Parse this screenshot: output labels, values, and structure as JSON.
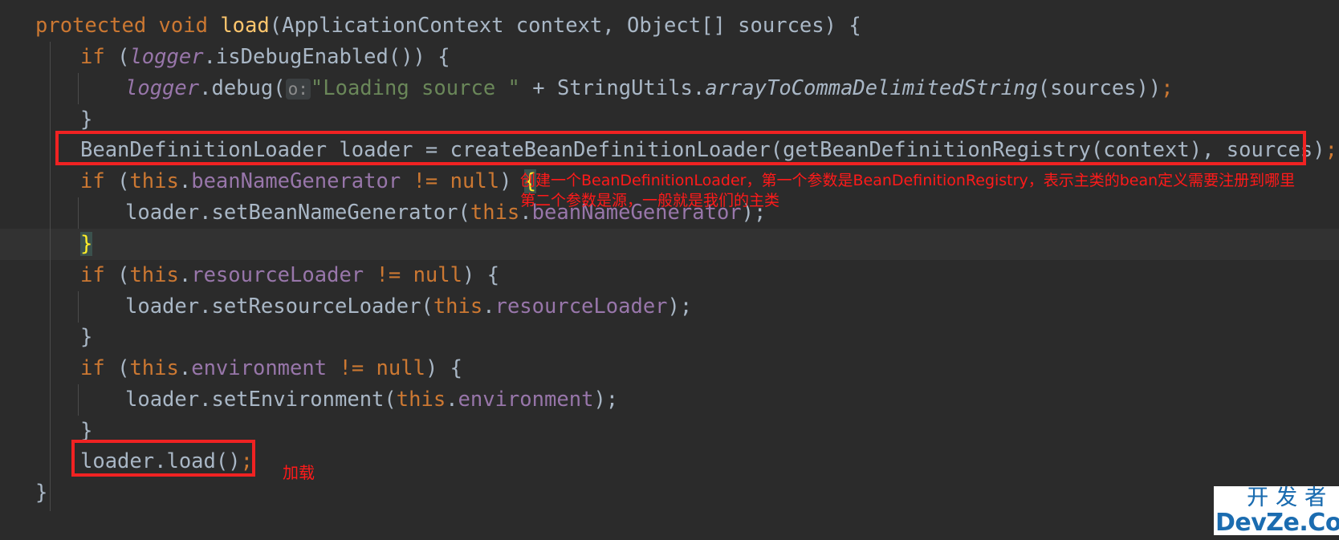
{
  "editor": {
    "background_color": "#2b2b2b",
    "current_line_color": "#323232",
    "indent_guide_color": "#4b4b4b",
    "annotation_color": "#ff1a1a",
    "box_color": "#f02222",
    "lines": [
      {
        "id": "line-1",
        "text": "protected void load(ApplicationContext context, Object[] sources) {"
      },
      {
        "id": "line-2",
        "text": "    if (logger.isDebugEnabled()) {"
      },
      {
        "id": "line-3",
        "text": "        logger.debug( o: \"Loading source \" + StringUtils.arrayToCommaDelimitedString(sources));",
        "param_hint": "o:"
      },
      {
        "id": "line-4",
        "text": "    }"
      },
      {
        "id": "line-5",
        "text": "    BeanDefinitionLoader loader = createBeanDefinitionLoader(getBeanDefinitionRegistry(context), sources);"
      },
      {
        "id": "line-6",
        "text": "    if (this.beanNameGenerator != null) {"
      },
      {
        "id": "line-7",
        "text": "        loader.setBeanNameGenerator(this.beanNameGenerator);"
      },
      {
        "id": "line-8",
        "text": "    }"
      },
      {
        "id": "line-9",
        "text": "    if (this.resourceLoader != null) {"
      },
      {
        "id": "line-10",
        "text": "        loader.setResourceLoader(this.resourceLoader);"
      },
      {
        "id": "line-11",
        "text": "    }"
      },
      {
        "id": "line-12",
        "text": "    if (this.environment != null) {"
      },
      {
        "id": "line-13",
        "text": "        loader.setEnvironment(this.environment);"
      },
      {
        "id": "line-14",
        "text": "    }"
      },
      {
        "id": "line-15",
        "text": "    loader.load();"
      },
      {
        "id": "line-16",
        "text": "}"
      }
    ],
    "tokens": {
      "l1": {
        "protected": "protected",
        "void": "void",
        "load": "load",
        "open_paren": "(",
        "application_context": "ApplicationContext",
        "context": " context",
        "comma": ", ",
        "object_arr": "Object[]",
        "sources": " sources",
        "close": ") {"
      },
      "l2": {
        "if": "if",
        "open": " (",
        "logger": "logger",
        "call": ".isDebugEnabled()) {"
      },
      "l3": {
        "logger": "logger",
        "debug": ".debug(",
        "hint": "o:",
        "string": "\"Loading source \"",
        "plus": " + ",
        "string_utils": "StringUtils",
        "dot": ".",
        "method": "arrayToCommaDelimitedString",
        "args": "(sources))",
        "semi": ";"
      },
      "l4": {
        "brace": "}"
      },
      "l5": {
        "type": "BeanDefinitionLoader",
        "var": " loader = ",
        "call": "createBeanDefinitionLoader(getBeanDefinitionRegistry(context), sources)",
        "semi": ";"
      },
      "l6": {
        "if": "if",
        "open": " (",
        "this": "this",
        "dot": ".",
        "field": "beanNameGenerator",
        "ne": " != ",
        "null": "null",
        "close": ") ",
        "brace": "{"
      },
      "l7": {
        "loader": "loader.setBeanNameGenerator(",
        "this": "this",
        "dot": ".",
        "field": "beanNameGenerator",
        "close": ");"
      },
      "l8": {
        "brace": "}"
      },
      "l9": {
        "if": "if",
        "open": " (",
        "this": "this",
        "dot": ".",
        "field": "resourceLoader",
        "ne": " != ",
        "null": "null",
        "close": ") {"
      },
      "l10": {
        "loader": "loader.setResourceLoader(",
        "this": "this",
        "dot": ".",
        "field": "resourceLoader",
        "close": ");"
      },
      "l11": {
        "brace": "}"
      },
      "l12": {
        "if": "if",
        "open": " (",
        "this": "this",
        "dot": ".",
        "field": "environment",
        "ne": " != ",
        "null": "null",
        "close": ") {"
      },
      "l13": {
        "loader": "loader.setEnvironment(",
        "this": "this",
        "dot": ".",
        "field": "environment",
        "close": ");"
      },
      "l14": {
        "brace": "}"
      },
      "l15": {
        "call": "loader.load()",
        "semi": ";"
      },
      "l16": {
        "brace": "}"
      }
    }
  },
  "annotations": {
    "bean_loader_line1": "创建一个BeanDefinitionLoader，第一个参数是BeanDefinitionRegistry，表示主类的bean定义需要注册到哪里",
    "bean_loader_line2": "第二个参数是源，一般就是我们的主类",
    "load_note": "加载"
  },
  "watermark": {
    "chinese": "开发者",
    "english": "DevZe.CoM",
    "color": "#1b6cb0"
  }
}
